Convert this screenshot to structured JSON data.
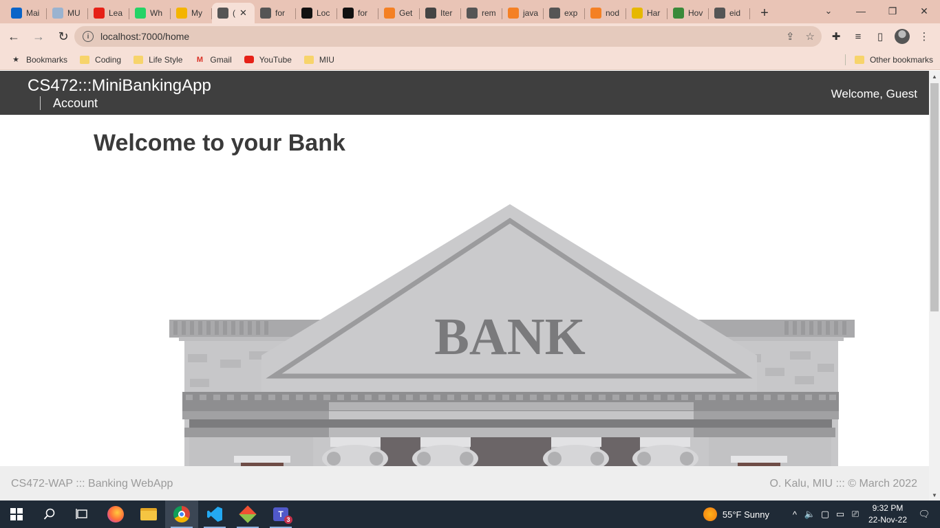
{
  "browser": {
    "tabs": [
      {
        "label": "Mai",
        "icon": "outlook-icon",
        "color": "#0a64c8"
      },
      {
        "label": "MU",
        "icon": "cloud-icon",
        "color": "#9ab3d0"
      },
      {
        "label": "Lea",
        "icon": "youtube-icon",
        "color": "#e62117"
      },
      {
        "label": "Wh",
        "icon": "whatsapp-icon",
        "color": "#25d366"
      },
      {
        "label": "My",
        "icon": "drive-icon",
        "color": "#f4b400"
      },
      {
        "label": "(",
        "icon": "globe-icon",
        "color": "#555555",
        "active": true
      },
      {
        "label": "for",
        "icon": "globe-icon",
        "color": "#555555"
      },
      {
        "label": "Loc",
        "icon": "medium-icon",
        "color": "#111111"
      },
      {
        "label": "for",
        "icon": "medium-icon",
        "color": "#111111"
      },
      {
        "label": "Get",
        "icon": "stackoverflow-icon",
        "color": "#f48024"
      },
      {
        "label": "Iter",
        "icon": "paw-icon",
        "color": "#444444"
      },
      {
        "label": "rem",
        "icon": "globe-icon",
        "color": "#555555"
      },
      {
        "label": "java",
        "icon": "stackoverflow-icon",
        "color": "#f48024"
      },
      {
        "label": "exp",
        "icon": "globe-icon",
        "color": "#555555"
      },
      {
        "label": "nod",
        "icon": "stackoverflow-icon",
        "color": "#f48024"
      },
      {
        "label": "Har",
        "icon": "emoji-icon",
        "color": "#e6b800"
      },
      {
        "label": "Hov",
        "icon": "infinity-icon",
        "color": "#3a8a3a"
      },
      {
        "label": "eid",
        "icon": "globe-icon",
        "color": "#555555"
      }
    ],
    "new_tab": "+",
    "url": "localhost:7000/home",
    "bookmarks": [
      {
        "label": "Bookmarks",
        "icon": "star-icon"
      },
      {
        "label": "Coding",
        "icon": "folder-icon"
      },
      {
        "label": "Life Style",
        "icon": "folder-icon"
      },
      {
        "label": "Gmail",
        "icon": "gmail-icon"
      },
      {
        "label": "YouTube",
        "icon": "youtube-icon"
      },
      {
        "label": "MIU",
        "icon": "folder-icon"
      }
    ],
    "other_bookmarks": "Other bookmarks"
  },
  "app": {
    "brand": "CS472:::MiniBankingApp",
    "nav_account": "Account",
    "welcome_user": "Welcome, Guest",
    "heading": "Welcome to your Bank",
    "bank_sign": "BANK",
    "footer_left": "CS472-WAP ::: Banking WebApp",
    "footer_right": "O. Kalu, MIU ::: © March 2022"
  },
  "taskbar": {
    "weather": "55°F  Sunny",
    "time": "9:32 PM",
    "date": "22-Nov-22",
    "teams_badge": "3"
  }
}
